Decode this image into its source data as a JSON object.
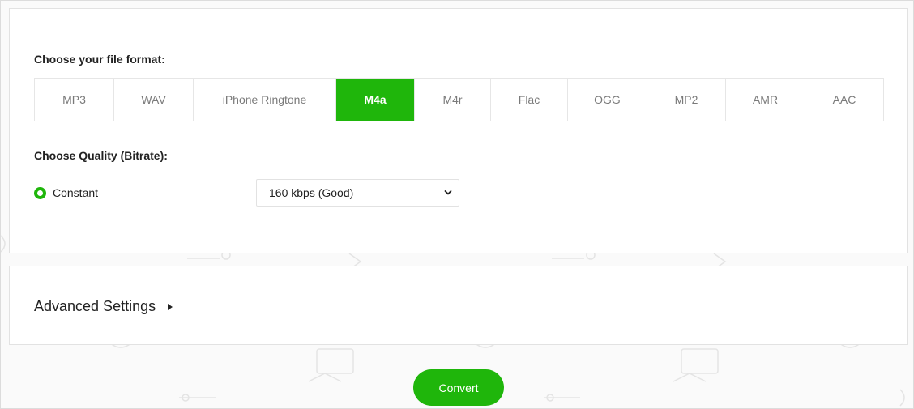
{
  "format_section": {
    "label": "Choose your file format:",
    "formats": [
      {
        "label": "MP3"
      },
      {
        "label": "WAV"
      },
      {
        "label": "iPhone Ringtone"
      },
      {
        "label": "M4a"
      },
      {
        "label": "M4r"
      },
      {
        "label": "Flac"
      },
      {
        "label": "OGG"
      },
      {
        "label": "MP2"
      },
      {
        "label": "AMR"
      },
      {
        "label": "AAC"
      }
    ],
    "selected": "M4a"
  },
  "quality_section": {
    "label": "Choose Quality (Bitrate):",
    "mode_label": "Constant",
    "bitrate_value": "160 kbps (Good)"
  },
  "advanced": {
    "title": "Advanced Settings"
  },
  "actions": {
    "convert_label": "Convert"
  },
  "colors": {
    "accent": "#1fb60b"
  },
  "icons": {
    "radio": "radio-selected-icon",
    "select": "chevron-down-icon",
    "advanced": "caret-right-icon"
  }
}
